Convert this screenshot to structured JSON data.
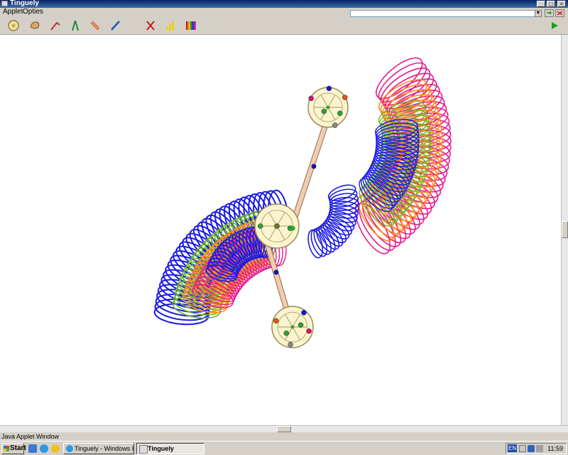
{
  "window": {
    "title": "Tinguely"
  },
  "menu": {
    "items": [
      "Applet",
      "Opties"
    ]
  },
  "toolbar": {
    "tools": [
      {
        "name": "gear-tool",
        "icon": "gear-icon"
      },
      {
        "name": "shape-tool",
        "icon": "eraser-blob-icon"
      },
      {
        "name": "crank-tool",
        "icon": "crank-icon"
      },
      {
        "name": "compass-tool",
        "icon": "compass-icon"
      },
      {
        "name": "rod-tool",
        "icon": "rod-icon"
      },
      {
        "name": "pen-tool",
        "icon": "pen-icon"
      },
      {
        "name": "delete-tool",
        "icon": "x-icon"
      },
      {
        "name": "speed-tool",
        "icon": "bar-levels-icon"
      },
      {
        "name": "color-tool",
        "icon": "color-palette-icon"
      }
    ],
    "play": "play-icon"
  },
  "status": {
    "text": "Java Applet Window"
  },
  "taskbar": {
    "start_label": "Start",
    "tasks": [
      {
        "label": "Tinguely - Windows Inter...",
        "active": false
      },
      {
        "label": "Tinguely",
        "active": true
      }
    ],
    "language": "EN",
    "clock": "11:59"
  },
  "colors": {
    "title_bar": "#0a246a",
    "blue_trace": "#1a1ae6",
    "magenta_trace": "#e6198c",
    "orange_trace": "#ff8a1e",
    "green_trace": "#6fb52a",
    "gear_fill": "#fbf5cf",
    "rod_fill": "#f1cdb0"
  }
}
